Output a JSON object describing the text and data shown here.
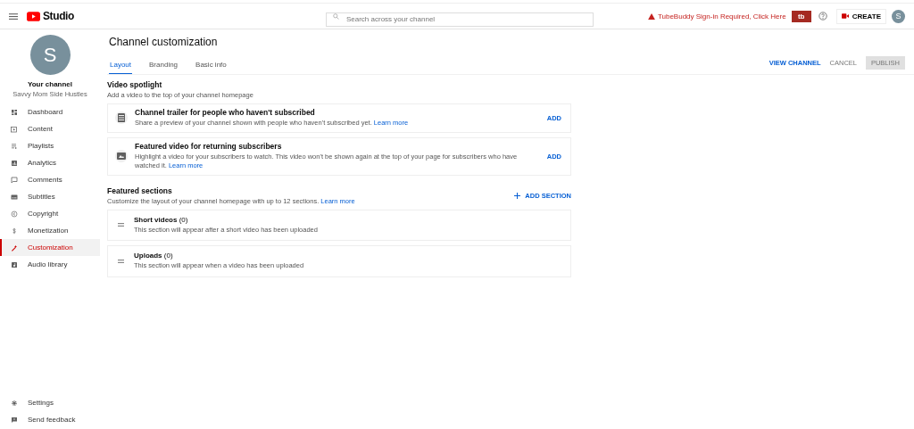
{
  "header": {
    "logo_text": "Studio",
    "search": {
      "placeholder": "Search across your channel"
    },
    "warning": "TubeBuddy Sign-in Required, Click Here",
    "tb_badge": "tb",
    "create": "CREATE",
    "avatar": "S"
  },
  "sidebar": {
    "avatar": "S",
    "channel_title": "Your channel",
    "channel_name": "Savvy Mom Side Hustles",
    "items": [
      {
        "label": "Dashboard",
        "selected": false
      },
      {
        "label": "Content",
        "selected": false
      },
      {
        "label": "Playlists",
        "selected": false
      },
      {
        "label": "Analytics",
        "selected": false
      },
      {
        "label": "Comments",
        "selected": false
      },
      {
        "label": "Subtitles",
        "selected": false
      },
      {
        "label": "Copyright",
        "selected": false
      },
      {
        "label": "Monetization",
        "selected": false
      },
      {
        "label": "Customization",
        "selected": true
      },
      {
        "label": "Audio library",
        "selected": false
      }
    ],
    "bottom_items": [
      {
        "label": "Settings"
      },
      {
        "label": "Send feedback"
      }
    ]
  },
  "page": {
    "title": "Channel customization",
    "tabs": [
      {
        "label": "Layout",
        "selected": true
      },
      {
        "label": "Branding",
        "selected": false
      },
      {
        "label": "Basic info",
        "selected": false
      }
    ],
    "actions": {
      "view_channel": "VIEW CHANNEL",
      "cancel": "CANCEL",
      "publish": {
        "label": "PUBLISH",
        "disabled": true
      }
    },
    "spotlight": {
      "title": "Video spotlight",
      "subtitle": "Add a video to the top of your channel homepage",
      "cards": [
        {
          "title": "Channel trailer for people who haven't subscribed",
          "text": "Share a preview of your channel shown with people who haven't subscribed yet.",
          "link": "Learn more",
          "action": "ADD"
        },
        {
          "title": "Featured video for returning subscribers",
          "text": "Highlight a video for your subscribers to watch. This video won't be shown again at the top of your page for subscribers who have watched it.",
          "link": "Learn more",
          "action": "ADD"
        }
      ]
    },
    "featured": {
      "title": "Featured sections",
      "subtitle": "Customize the layout of your channel homepage with up to 12 sections.",
      "link": "Learn more",
      "add": "ADD SECTION",
      "sections": [
        {
          "title": "**Short videos** (0)",
          "text": "This section will appear after a short video has been uploaded"
        },
        {
          "title": "**Uploads** (0)",
          "text": "This section will appear when a video has been uploaded"
        }
      ]
    }
  }
}
